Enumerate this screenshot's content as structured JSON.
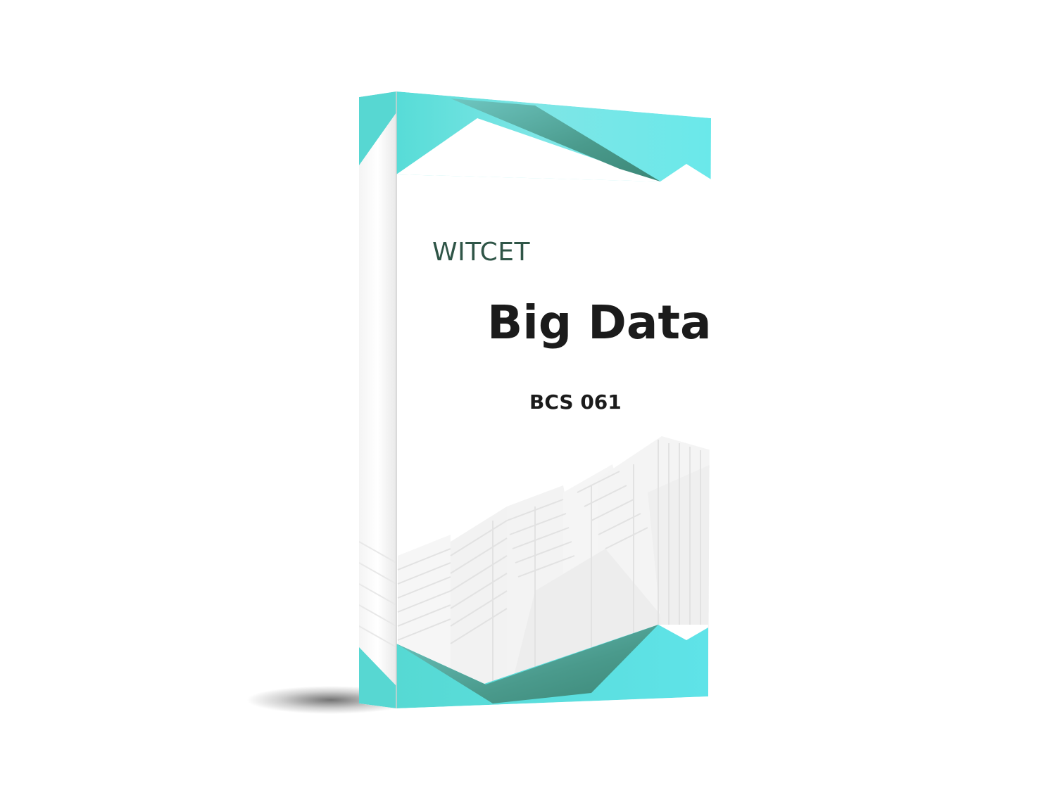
{
  "cover": {
    "brand": "WITCET",
    "title": "Big Data",
    "course_code": "BCS 061"
  },
  "colors": {
    "accent_teal": "#5ee3e3",
    "accent_dark_teal": "#3f8f7f",
    "brand_text": "#2f5547",
    "title_text": "#1b1b1b",
    "building_lines": "#e6e6e6"
  }
}
